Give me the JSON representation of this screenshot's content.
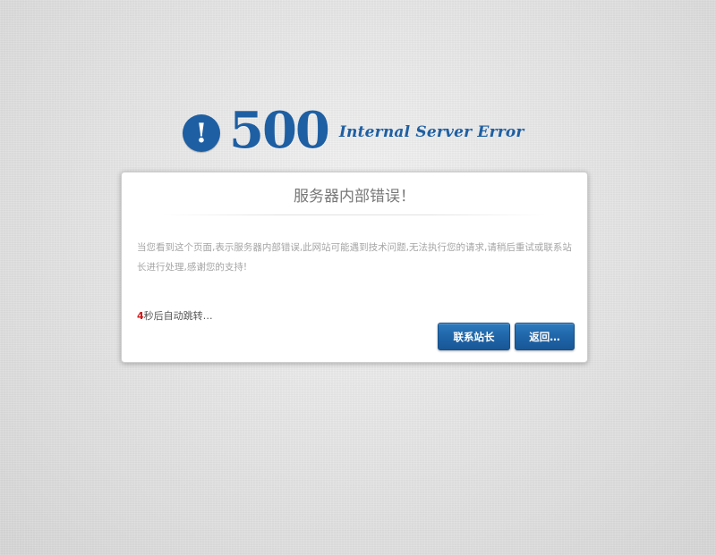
{
  "header": {
    "badge_symbol": "!",
    "code": "500",
    "label": "Internal Server Error",
    "accent_color": "#1e5fa3"
  },
  "dialog": {
    "title": "服务器内部错误！",
    "message": "当您看到这个页面,表示服务器内部错误,此网站可能遇到技术问题,无法执行您的请求,请稍后重试或联系站长进行处理,感谢您的支持!",
    "countdown_value": "4",
    "countdown_suffix": "秒后自动跳转…",
    "countdown_color": "#d11a1a"
  },
  "buttons": {
    "contact_label": "联系站长",
    "back_label": "返回…"
  }
}
